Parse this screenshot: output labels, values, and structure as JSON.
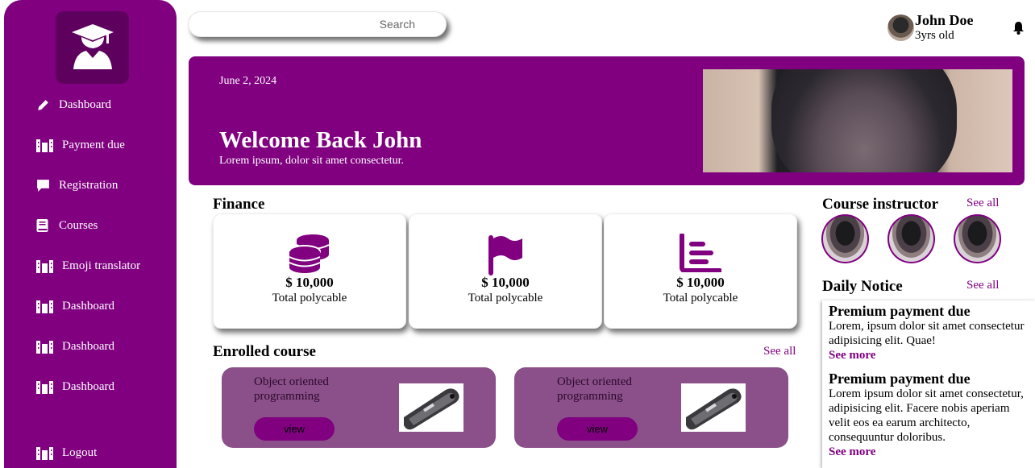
{
  "sidebar": {
    "items": [
      {
        "label": "Dashboard",
        "icon": "pencil-icon"
      },
      {
        "label": "Payment due",
        "icon": "building-icon"
      },
      {
        "label": "Registration",
        "icon": "chat-icon"
      },
      {
        "label": "Courses",
        "icon": "book-icon"
      },
      {
        "label": "Emoji translator",
        "icon": "building-icon"
      },
      {
        "label": "Dashboard",
        "icon": "building-icon"
      },
      {
        "label": "Dashboard",
        "icon": "building-icon"
      },
      {
        "label": "Dashboard",
        "icon": "building-icon"
      }
    ],
    "logout_label": "Logout"
  },
  "search": {
    "placeholder": "Search"
  },
  "user": {
    "name": "John Doe",
    "age": "3yrs old"
  },
  "banner": {
    "date": "June 2, 2024",
    "title": "Welcome Back John",
    "subtitle": "Lorem ipsum, dolor sit amet consectetur."
  },
  "finance": {
    "title": "Finance",
    "cards": [
      {
        "amount": "$ 10,000",
        "label": "Total polycable",
        "icon": "coins-icon"
      },
      {
        "amount": "$ 10,000",
        "label": "Total polycable",
        "icon": "flag-icon"
      },
      {
        "amount": "$ 10,000",
        "label": "Total polycable",
        "icon": "chart-icon"
      }
    ]
  },
  "enrolled": {
    "title": "Enrolled course",
    "see_all": "See all",
    "courses": [
      {
        "name": "Object oriented programming",
        "button": "view"
      },
      {
        "name": "Object oriented programming",
        "button": "view"
      }
    ]
  },
  "instructors": {
    "title": "Course instructor",
    "see_all": "See all"
  },
  "notices": {
    "title": "Daily Notice",
    "see_all": "See all",
    "items": [
      {
        "title": "Premium payment due",
        "body": "Lorem, ipsum dolor sit amet consectetur adipisicing elit. Quae!",
        "more": "See more"
      },
      {
        "title": "Premium payment due",
        "body": "Lorem ipsum dolor sit amet consectetur, adipisicing elit. Facere nobis aperiam velit eos ea earum architecto, consequuntur doloribus.",
        "more": "See more"
      }
    ]
  },
  "colors": {
    "accent": "#800080",
    "course_card": "#8b508a",
    "logo_bg": "#5e005e"
  }
}
